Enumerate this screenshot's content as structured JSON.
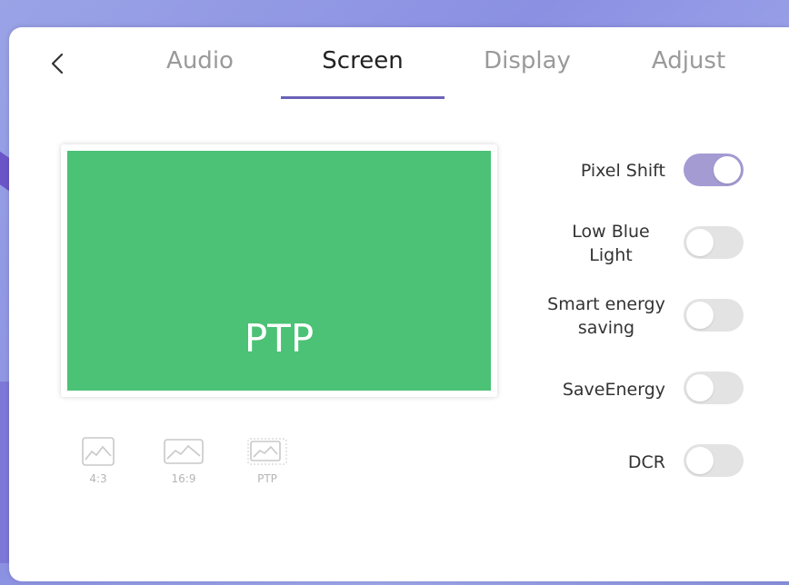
{
  "tabs": [
    {
      "label": "Audio",
      "active": false
    },
    {
      "label": "Screen",
      "active": true
    },
    {
      "label": "Display",
      "active": false
    },
    {
      "label": "Adjust",
      "active": false
    }
  ],
  "preview": {
    "label": "PTP",
    "color": "#4cc276"
  },
  "aspect_ratios": [
    {
      "label": "4:3",
      "icon": "landscape-image-icon"
    },
    {
      "label": "16:9",
      "icon": "landscape-image-icon"
    },
    {
      "label": "PTP",
      "icon": "landscape-image-icon"
    }
  ],
  "settings": [
    {
      "label": "Pixel Shift",
      "on": true
    },
    {
      "label": "Low Blue Light",
      "on": false
    },
    {
      "label": "Smart energy saving",
      "on": false
    },
    {
      "label": "SaveEnergy",
      "on": false
    },
    {
      "label": "DCR",
      "on": false
    }
  ],
  "colors": {
    "accent": "#6a62b8",
    "toggle_on": "#a39bd2",
    "toggle_off": "#e3e3e3"
  }
}
